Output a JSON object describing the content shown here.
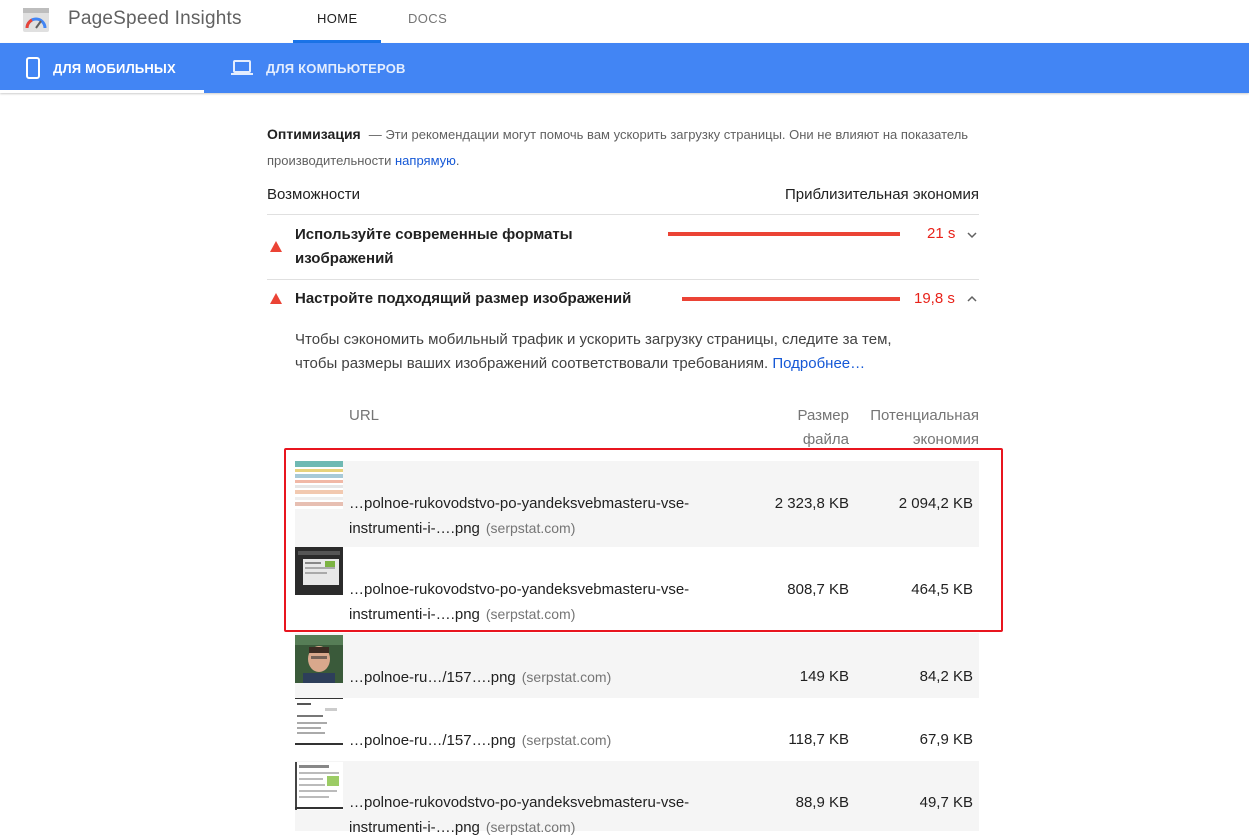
{
  "app": {
    "title": "PageSpeed Insights"
  },
  "nav": {
    "home": "HOME",
    "docs": "DOCS"
  },
  "devices": {
    "mobile": "ДЛЯ МОБИЛЬНЫХ",
    "desktop": "ДЛЯ КОМПЬЮТЕРОВ"
  },
  "optimization": {
    "title": "Оптимизация",
    "text": "— Эти рекомендации могут помочь вам ускорить загрузку страницы. Они не влияют на показатель производительности",
    "link": "напрямую",
    "period": "."
  },
  "opportunities": {
    "left_header": "Возможности",
    "right_header": "Приблизительная экономия",
    "audits": [
      {
        "title_line1": "Используйте современные форматы",
        "title_line2": "изображений",
        "saving": "21 s",
        "bar_fraction": 1.0,
        "chevron": "chevron-down-icon"
      },
      {
        "title": "Настройте подходящий размер изображений",
        "saving": "19,8 s",
        "bar_fraction": 0.94,
        "chevron": "chevron-up-icon"
      }
    ]
  },
  "details": {
    "description_line1": "Чтобы сэкономить мобильный трафик и ускорить загрузку страницы, следите за тем,",
    "description_line2": "чтобы размеры ваших изображений соответствовали требованиям.",
    "learn_more": "Подробнее…",
    "table": {
      "col_url": "URL",
      "col_size_line1": "Размер",
      "col_size_line2": "файла",
      "col_saving_line1": "Потенциальная",
      "col_saving_line2": "экономия",
      "rows": [
        {
          "url_line1": "…polnoe-rukovodstvo-po-yandeksvebmasteru-vse-",
          "url_line2": "instrumenti-i-….png",
          "domain": "(serpstat.com)",
          "size": "2 323,8 KB",
          "saving": "2 094,2 KB"
        },
        {
          "url_line1": "…polnoe-rukovodstvo-po-yandeksvebmasteru-vse-",
          "url_line2": "instrumenti-i-….png",
          "domain": "(serpstat.com)",
          "size": "808,7 KB",
          "saving": "464,5 KB"
        },
        {
          "url": "…polnoe-ru…/157….png",
          "domain": "(serpstat.com)",
          "size": "149 KB",
          "saving": "84,2 KB"
        },
        {
          "url": "…polnoe-ru…/157….png",
          "domain": "(serpstat.com)",
          "size": "118,7 KB",
          "saving": "67,9 KB"
        },
        {
          "url_line1": "…polnoe-rukovodstvo-po-yandeksvebmasteru-vse-",
          "url_line2": "instrumenti-i-….png",
          "domain": "(serpstat.com)",
          "size": "88,9 KB",
          "saving": "49,7 KB"
        }
      ]
    }
  },
  "colors": {
    "brand_blue": "#4285f4",
    "fail_red": "#eb4335",
    "highlight_red": "#e8151f",
    "link_blue": "#1558d6"
  }
}
